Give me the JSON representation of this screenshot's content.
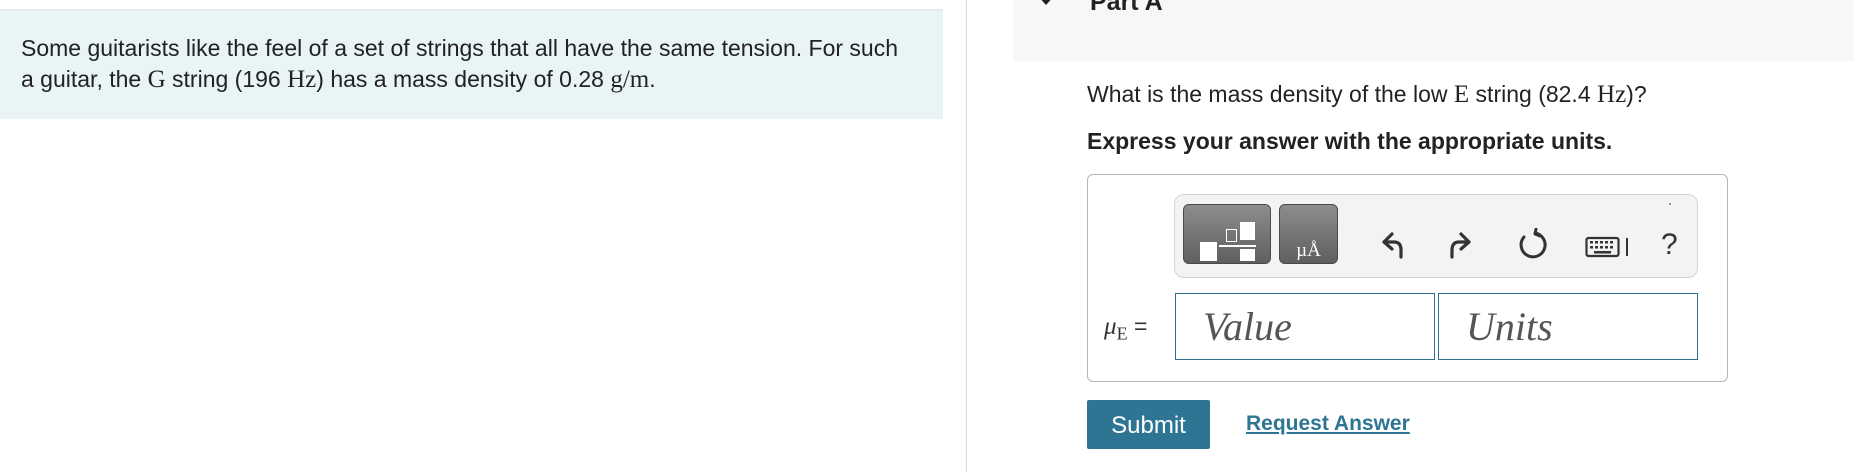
{
  "problem": {
    "line1": "Some guitarists like the feel of a set of strings that all have the same tension. For such",
    "line2_a": "a guitar, the ",
    "line2_string": "G",
    "line2_b": " string (196 ",
    "line2_unit1": "Hz",
    "line2_c": ") has a mass density of 0.28 ",
    "line2_unit2": "g/m",
    "line2_d": "."
  },
  "part": {
    "title": "Part A"
  },
  "question": {
    "text_a": "What is the mass density of the low ",
    "string": "E",
    "text_b": " string (82.4 ",
    "unit": "Hz",
    "text_c": ")?",
    "instruction": "Express your answer with the appropriate units."
  },
  "toolbar": {
    "template_icon": "fraction-template-icon",
    "units_icon": "units-icon",
    "units_glyph": "µÅ",
    "undo_icon": "undo-icon",
    "redo_icon": "redo-icon",
    "reset_icon": "reset-icon",
    "keyboard_icon": "keyboard-icon",
    "help_label": "?"
  },
  "answer": {
    "symbol": "μ",
    "subscript": "E",
    "equals": " =",
    "value_placeholder": "Value",
    "units_placeholder": "Units"
  },
  "actions": {
    "submit_label": "Submit",
    "request_label": "Request Answer"
  },
  "colors": {
    "accent": "#2e7594",
    "problem_bg": "#e8f4f6",
    "template_btn": "#6f6f6f"
  }
}
